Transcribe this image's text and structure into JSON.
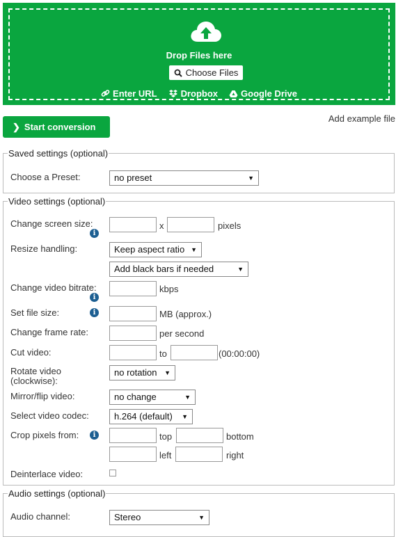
{
  "upload": {
    "drop_text": "Drop Files here",
    "choose_label": "Choose Files",
    "sources": [
      "Enter URL",
      "Dropbox",
      "Google Drive"
    ]
  },
  "actions": {
    "start_label": "Start conversion",
    "example_label": "Add example file"
  },
  "saved": {
    "legend": "Saved settings (optional)",
    "preset_label": "Choose a Preset:",
    "preset_value": "no preset"
  },
  "video": {
    "legend": "Video settings (optional)",
    "screen_size_label": "Change screen size:",
    "x_sep": "x",
    "pixels": "pixels",
    "resize_label": "Resize handling:",
    "resize_value": "Keep aspect ratio",
    "bars_value": "Add black bars if needed",
    "bitrate_label": "Change video bitrate:",
    "kbps": "kbps",
    "filesize_label": "Set file size:",
    "mb": "MB (approx.)",
    "framerate_label": "Change frame rate:",
    "per_second": "per second",
    "cut_label": "Cut video:",
    "to": "to",
    "time_format": "(00:00:00)",
    "rotate_label_1": "Rotate video",
    "rotate_label_2": "(clockwise):",
    "rotate_value": "no rotation",
    "mirror_label": "Mirror/flip video:",
    "mirror_value": "no change",
    "codec_label": "Select video codec:",
    "codec_value": "h.264 (default)",
    "crop_label": "Crop pixels from:",
    "top": "top",
    "bottom": "bottom",
    "left": "left",
    "right": "right",
    "deinterlace_label": "Deinterlace video:"
  },
  "audio": {
    "legend": "Audio settings (optional)",
    "channel_label": "Audio channel:",
    "channel_value": "Stereo"
  },
  "colors": {
    "accent": "#0aa63f",
    "info": "#1d5f92"
  }
}
